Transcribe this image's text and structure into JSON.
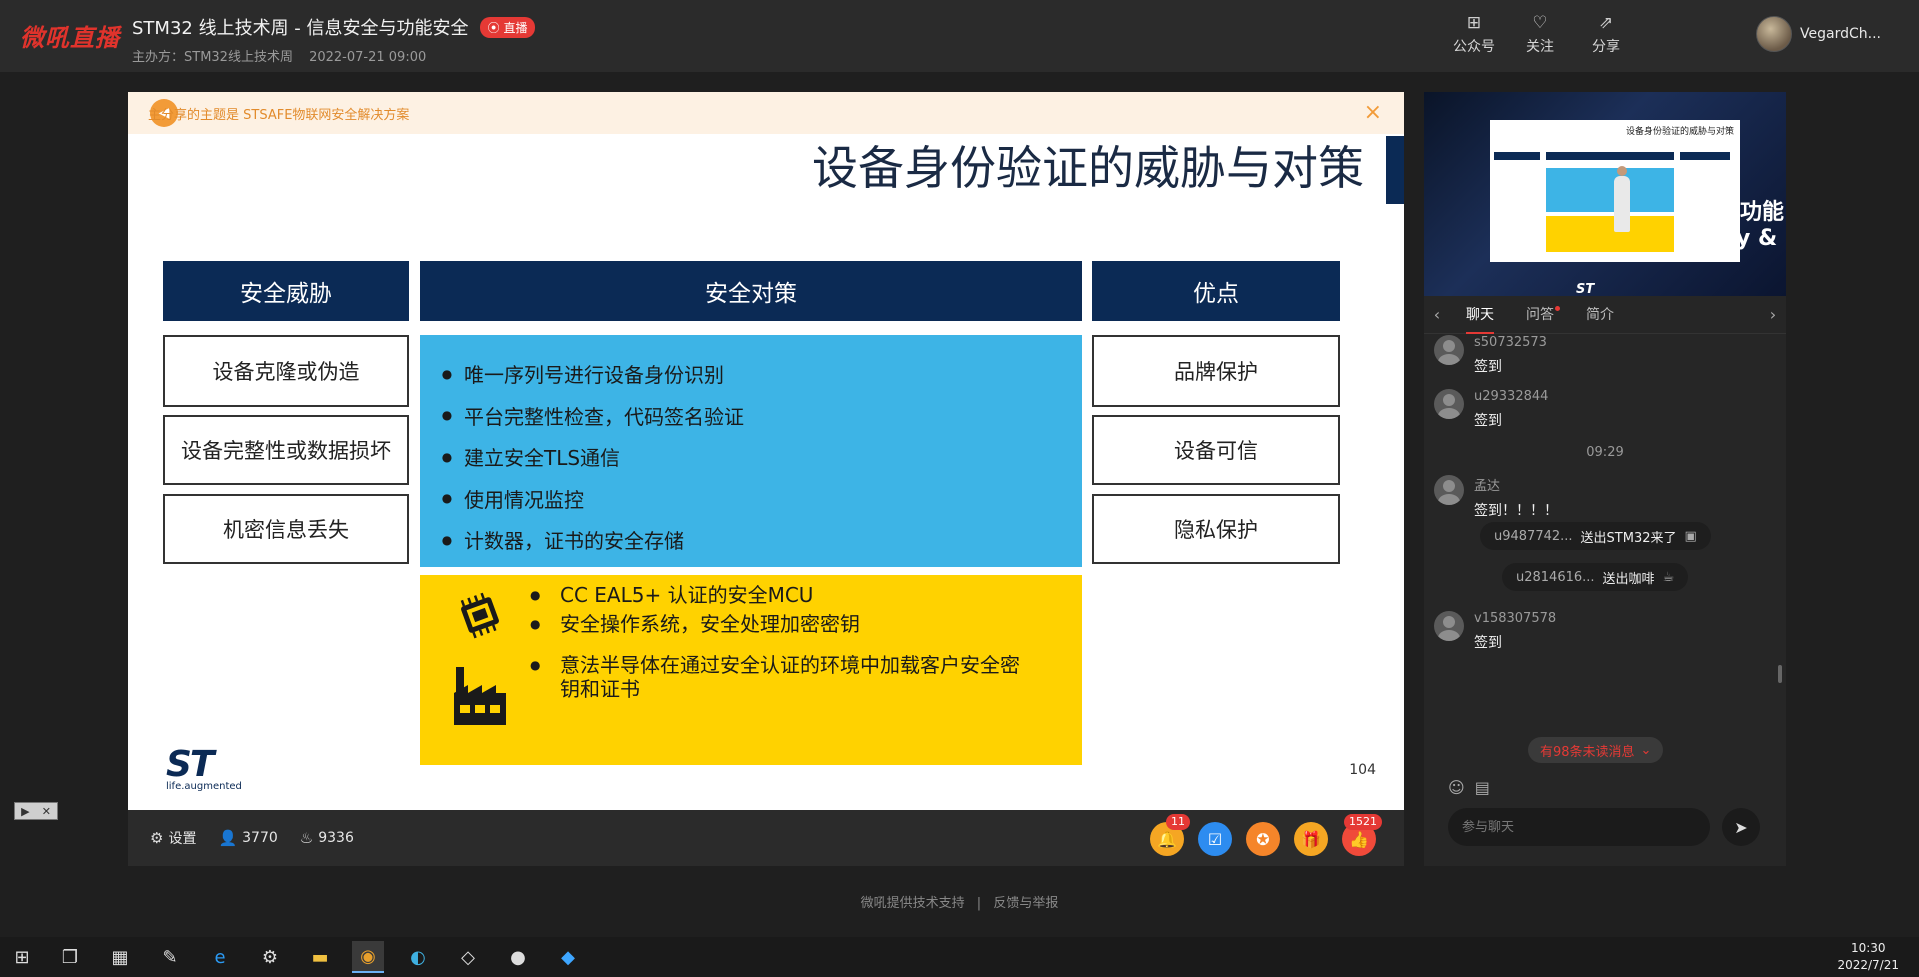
{
  "app": {
    "logo_text": "微吼直播",
    "live_badge": "直播"
  },
  "header": {
    "title": "STM32 线上技术周 - 信息安全与功能安全",
    "organizer": "主办方：STM32线上技术周",
    "datetime": "2022-07-21 09:00",
    "actions": [
      {
        "label": "公众号",
        "icon": "qrcode-icon"
      },
      {
        "label": "关注",
        "icon": "heart-icon"
      },
      {
        "label": "分享",
        "icon": "share-icon"
      }
    ],
    "user_name": "VegardCh..."
  },
  "notice": {
    "text": "主分享的主题是 STSAFE物联网安全解决方案"
  },
  "slide": {
    "title": "设备身份验证的威胁与对策",
    "headers": [
      "安全威胁",
      "安全对策",
      "优点"
    ],
    "threats": [
      "设备克隆或伪造",
      "设备完整性或数据损坏",
      "机密信息丢失"
    ],
    "countermeasures": [
      "唯一序列号进行设备身份识别",
      "平台完整性检查，代码签名验证",
      "建立安全TLS通信",
      "使用情况监控",
      "计数器，证书的安全存储"
    ],
    "hw_items": [
      "CC EAL5+ 认证的安全MCU",
      "安全操作系统，安全处理加密密钥",
      "意法半导体在通过安全认证的环境中加载客户安全密",
      "钥和证书"
    ],
    "benefits": [
      "品牌保护",
      "设备可信",
      "隐私保护"
    ],
    "logo_text": "ST",
    "logo_tagline": "life.augmented",
    "page_number": "104"
  },
  "controls": {
    "settings_label": "设置",
    "viewers": "3770",
    "likes_count": "9336",
    "notification_badge": "11",
    "like_badge": "1521"
  },
  "side_video": {
    "screen_title": "设备身份验证的威胁与对策",
    "overlay_line1": "与功能",
    "overlay_line2": "ity &",
    "brand": "ST"
  },
  "tabs": [
    "聊天",
    "问答",
    "简介"
  ],
  "chat": {
    "messages": [
      {
        "user": "s50732573",
        "text": "签到"
      },
      {
        "user": "u29332844",
        "text": "签到"
      },
      {
        "user": "孟达",
        "text": "签到！！！！"
      },
      {
        "user": "v158307578",
        "text": "签到"
      }
    ],
    "time_separator": "09:29",
    "gifts": [
      {
        "user": "u9487742...",
        "action": "送出STM32来了"
      },
      {
        "user": "u2814616...",
        "action": "送出咖啡"
      }
    ],
    "unread_text": "有98条未读消息",
    "input_placeholder": "参与聊天"
  },
  "footer": {
    "support": "微吼提供技术支持",
    "report": "反馈与举报"
  },
  "taskbar": {
    "time": "10:30",
    "date": "2022/7/21"
  }
}
